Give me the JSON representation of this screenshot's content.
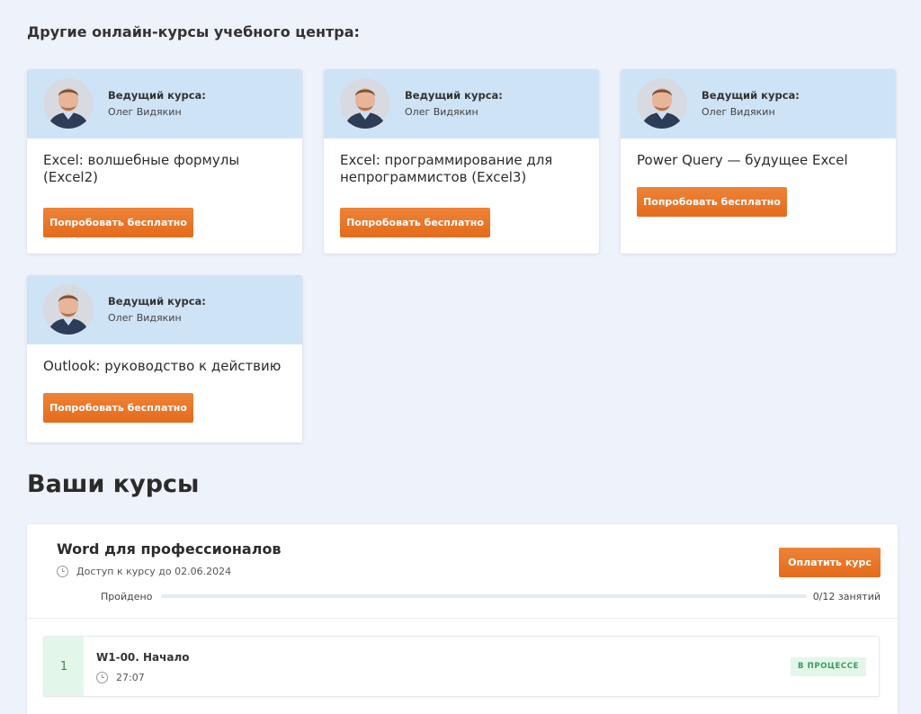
{
  "other_courses": {
    "heading": "Другие онлайн-курсы учебного центра:",
    "cards": [
      {
        "instructor_caption": "Ведущий курса:",
        "instructor_name": "Олег Видякин",
        "title": "Excel: волшебные формулы (Excel2)",
        "button": "Попробовать бесплатно"
      },
      {
        "instructor_caption": "Ведущий курса:",
        "instructor_name": "Олег Видякин",
        "title": "Excel: программирование для непрограммистов (Excel3)",
        "button": "Попробовать бесплатно"
      },
      {
        "instructor_caption": "Ведущий курса:",
        "instructor_name": "Олег Видякин",
        "title": "Power Query — будущее Excel",
        "button": "Попробовать бесплатно"
      },
      {
        "instructor_caption": "Ведущий курса:",
        "instructor_name": "Олег Видякин",
        "title": "Outlook: руководство к действию",
        "button": "Попробовать бесплатно"
      }
    ]
  },
  "your_courses": {
    "heading": "Ваши курсы",
    "course": {
      "title": "Word для профессионалов",
      "access": "Доступ к курсу до 02.06.2024",
      "pay_button": "Оплатить курс",
      "progress_label": "Пройдено",
      "progress_count": "0/12 занятий",
      "progress_fraction": 0,
      "lessons": [
        {
          "number": "1",
          "title": "W1-00. Начало",
          "duration": "27:07",
          "status": "В ПРОЦЕССЕ"
        }
      ]
    }
  },
  "colors": {
    "accent": "#e46b1c",
    "card_header": "#cfe3f6",
    "page_bg": "#eef2fa",
    "status_green": "#3a9a5e"
  },
  "icons": [
    "clock-icon"
  ]
}
